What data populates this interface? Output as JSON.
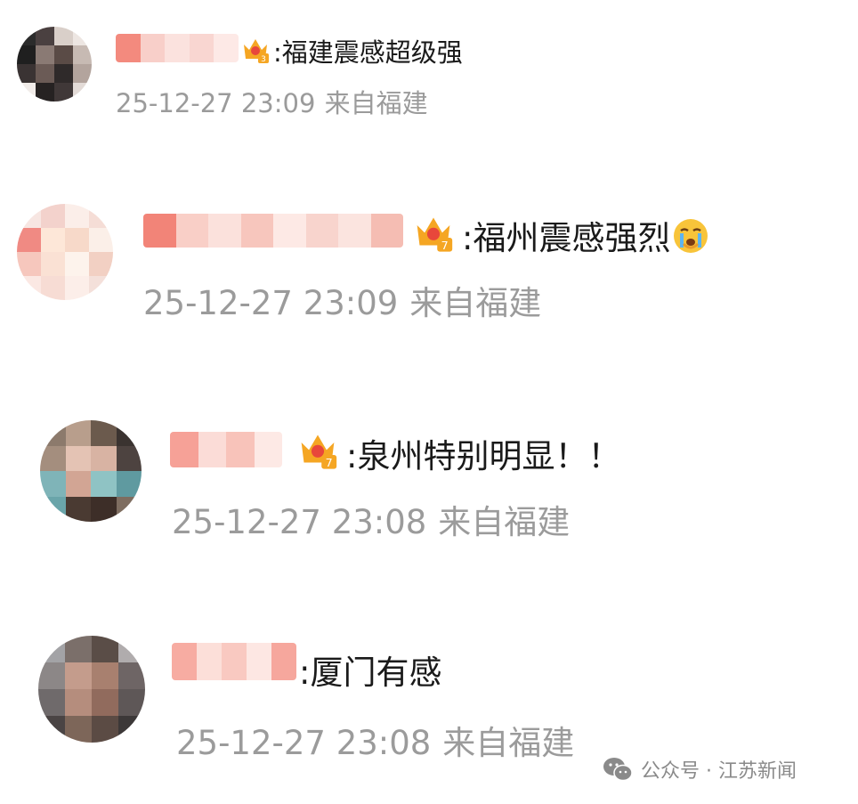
{
  "comments": [
    {
      "separator": ":",
      "text": "福建震感超级强",
      "date": "25-12-27 23:09",
      "location": "来自福建",
      "badge_level": "3"
    },
    {
      "separator": ":",
      "text": "福州震感强烈",
      "date": "25-12-27 23:09",
      "location": "来自福建",
      "badge_level": "7",
      "emoji": "crying-face-emoji"
    },
    {
      "separator": ":",
      "text": "泉州特别明显！！",
      "date": "25-12-27 23:08",
      "location": "来自福建",
      "badge_level": "7"
    },
    {
      "separator": ":",
      "text": "厦门有感",
      "date": "25-12-27 23:08",
      "location": "来自福建"
    }
  ],
  "watermark": {
    "icon": "wechat-icon",
    "text": "公众号 · 江苏新闻"
  },
  "colors": {
    "name_pink": "#f6b9b0",
    "meta_gray": "#9b9b9b",
    "crown_gold": "#f5a623",
    "crown_red": "#e8473b"
  }
}
